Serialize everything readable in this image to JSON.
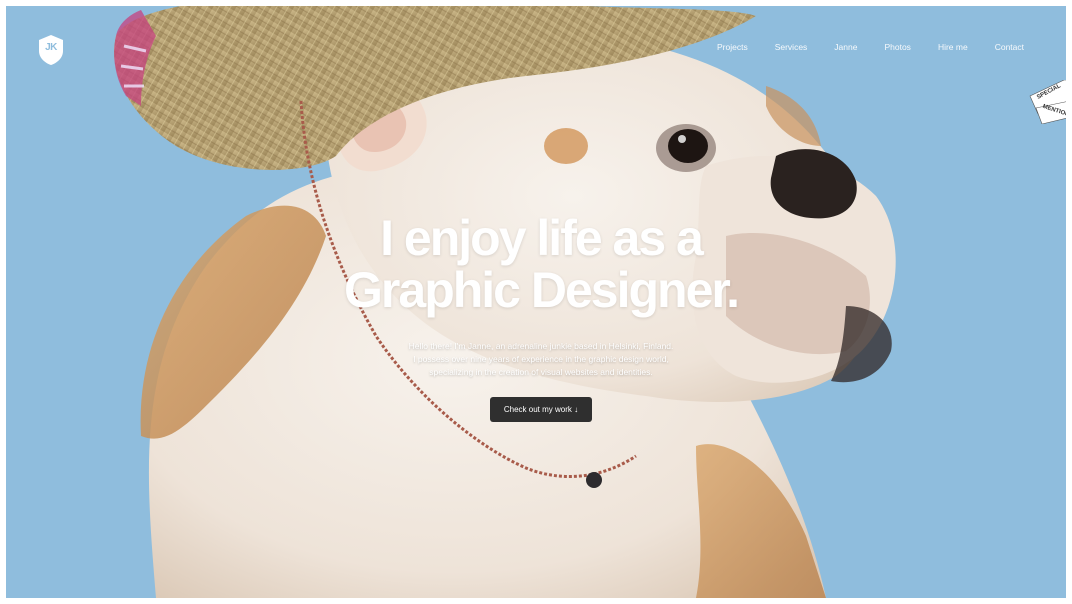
{
  "header": {
    "logo_text": "JK"
  },
  "nav": {
    "items": [
      "Projects",
      "Services",
      "Janne",
      "Photos",
      "Hire me",
      "Contact"
    ]
  },
  "ribbon": {
    "line1": "SPECIAL",
    "line2": "MENTION"
  },
  "hero": {
    "headline_line1": "I enjoy life as a",
    "headline_line2": "Graphic Designer.",
    "intro_line1": "Hello there! I'm Janne, an adrenaline junkie based in Helsinki, Finland.",
    "intro_line2": "I possess over nine years of experience in the graphic design world,",
    "intro_line3": "specializing in the creation of visual websites and identities.",
    "cta_label": "Check out my work ↓"
  },
  "colors": {
    "background": "#8fbddd",
    "cta_bg": "#2f2f2f",
    "text": "#ffffff"
  }
}
